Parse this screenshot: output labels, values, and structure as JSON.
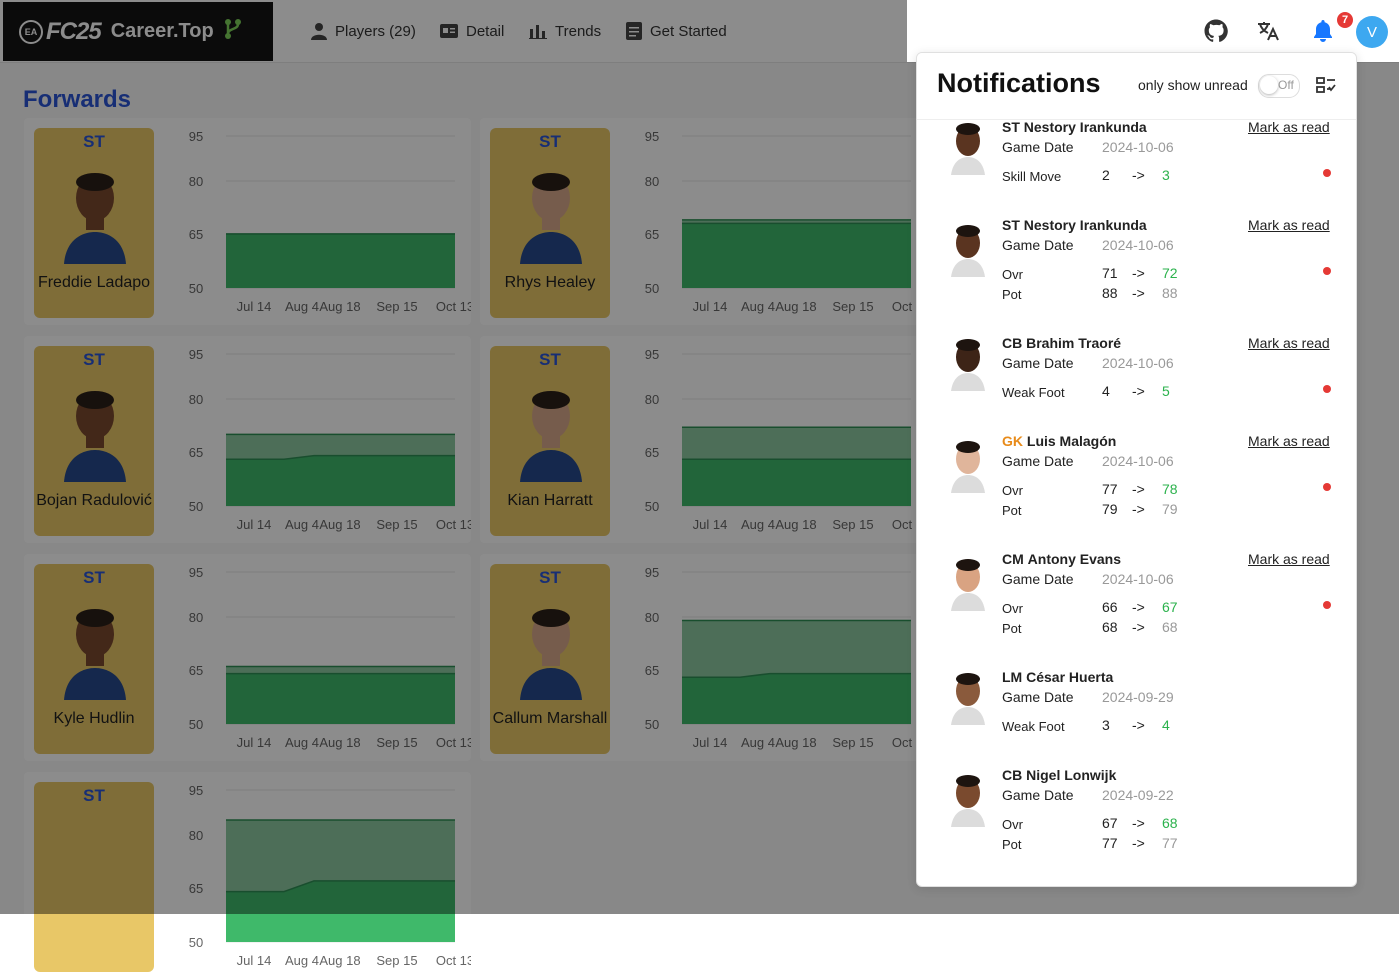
{
  "app": {
    "logo": {
      "ea": "EA",
      "fc": "FC25",
      "site": "Career.Top"
    },
    "nav": [
      {
        "label": "Players (29)",
        "icon": "person-icon"
      },
      {
        "label": "Detail",
        "icon": "id-card-icon"
      },
      {
        "label": "Trends",
        "icon": "bar-chart-icon"
      },
      {
        "label": "Get Started",
        "icon": "document-icon"
      }
    ],
    "section_title": "Forwards",
    "players": [
      {
        "pos": "ST",
        "name": "Freddie Ladapo"
      },
      {
        "pos": "ST",
        "name": "Rhys Healey"
      },
      {
        "pos": "ST",
        "name": "Bojan Radulović"
      },
      {
        "pos": "ST",
        "name": "Kian Harratt"
      },
      {
        "pos": "ST",
        "name": "Kyle Hudlin"
      },
      {
        "pos": "ST",
        "name": "Callum Marshall"
      },
      {
        "pos": "ST",
        "name": ""
      }
    ],
    "chart_y_ticks": [
      "95",
      "80",
      "65",
      "50"
    ],
    "chart_x_ticks": [
      "Jul 14",
      "Aug 4",
      "Aug 18",
      "Sep 15",
      "Oct 13"
    ]
  },
  "chart_data": [
    {
      "type": "area",
      "x": [
        "Jul 14",
        "Aug 4",
        "Aug 18",
        "Sep 15",
        "Oct 13"
      ],
      "ylim": [
        50,
        95
      ],
      "series": [
        {
          "values": [
            65,
            65,
            65,
            65,
            65
          ]
        },
        {
          "values": [
            65,
            65,
            65,
            65,
            65
          ]
        }
      ]
    },
    {
      "type": "area",
      "x": [
        "Jul 14",
        "Aug 4",
        "Aug 18",
        "Sep 15",
        "Oct 13"
      ],
      "ylim": [
        50,
        95
      ],
      "series": [
        {
          "values": [
            69,
            69,
            69,
            69,
            69
          ]
        },
        {
          "values": [
            68,
            68,
            68,
            68,
            68
          ]
        }
      ]
    },
    {
      "type": "area",
      "x": [
        "Jul 14",
        "Aug 4",
        "Aug 18",
        "Sep 15",
        "Oct 13"
      ],
      "ylim": [
        50,
        95
      ],
      "series": [
        {
          "values": [
            70,
            70,
            70,
            70,
            70
          ]
        },
        {
          "values": [
            63,
            63,
            64,
            64,
            64
          ]
        }
      ]
    },
    {
      "type": "area",
      "x": [
        "Jul 14",
        "Aug 4",
        "Aug 18",
        "Sep 15",
        "Oct 13"
      ],
      "ylim": [
        50,
        95
      ],
      "series": [
        {
          "values": [
            72,
            72,
            72,
            72,
            72
          ]
        },
        {
          "values": [
            63,
            63,
            63,
            63,
            63
          ]
        }
      ]
    },
    {
      "type": "area",
      "x": [
        "Jul 14",
        "Aug 4",
        "Aug 18",
        "Sep 15",
        "Oct 13"
      ],
      "ylim": [
        50,
        95
      ],
      "series": [
        {
          "values": [
            66,
            66,
            66,
            66,
            66
          ]
        },
        {
          "values": [
            64,
            64,
            64,
            64,
            64
          ]
        }
      ]
    },
    {
      "type": "area",
      "x": [
        "Jul 14",
        "Aug 4",
        "Aug 18",
        "Sep 15",
        "Oct 13"
      ],
      "ylim": [
        50,
        95
      ],
      "series": [
        {
          "values": [
            79,
            79,
            79,
            79,
            79
          ]
        },
        {
          "values": [
            63,
            63,
            64,
            64,
            64
          ]
        }
      ]
    },
    {
      "type": "area",
      "x": [
        "Jul 14",
        "Aug 4",
        "Aug 18",
        "Sep 15",
        "Oct 13"
      ],
      "ylim": [
        50,
        95
      ],
      "series": [
        {
          "values": [
            85,
            85,
            85,
            85,
            85
          ]
        },
        {
          "values": [
            64,
            64,
            67,
            67,
            67
          ]
        }
      ]
    }
  ],
  "header_icons": {
    "github": "github-icon",
    "translate": "translate-icon",
    "bell": "bell-icon",
    "badge": "7",
    "avatar": "V"
  },
  "colors": {
    "accent": "#2a55d6",
    "card_gold": "#e8c767",
    "green": "#2bb24c",
    "red": "#e53935",
    "chart_green": "#3fb96a"
  },
  "notifications": {
    "title": "Notifications",
    "unread_label": "only show unread",
    "toggle_text": "Off",
    "mark_label": "Mark as read",
    "items": [
      {
        "pos": "ST",
        "name": "Nestory Irankunda",
        "date_label": "Game Date",
        "date": "2024-10-06",
        "rows": [
          {
            "label": "Skill Move",
            "from": "2",
            "arrow": "->",
            "to": "3",
            "to_color": "green"
          }
        ],
        "unread": true
      },
      {
        "pos": "ST",
        "name": "Nestory Irankunda",
        "date_label": "Game Date",
        "date": "2024-10-06",
        "rows": [
          {
            "label": "Ovr",
            "from": "71",
            "arrow": "->",
            "to": "72",
            "to_color": "green"
          },
          {
            "label": "Pot",
            "from": "88",
            "arrow": "->",
            "to": "88",
            "to_color": "gray"
          }
        ],
        "unread": true
      },
      {
        "pos": "CB",
        "name": "Brahim Traoré",
        "date_label": "Game Date",
        "date": "2024-10-06",
        "rows": [
          {
            "label": "Weak Foot",
            "from": "4",
            "arrow": "->",
            "to": "5",
            "to_color": "green"
          }
        ],
        "unread": true
      },
      {
        "pos": "GK",
        "name": "Luis Malagón",
        "date_label": "Game Date",
        "date": "2024-10-06",
        "rows": [
          {
            "label": "Ovr",
            "from": "77",
            "arrow": "->",
            "to": "78",
            "to_color": "green"
          },
          {
            "label": "Pot",
            "from": "79",
            "arrow": "->",
            "to": "79",
            "to_color": "gray"
          }
        ],
        "unread": true
      },
      {
        "pos": "CM",
        "name": "Antony Evans",
        "date_label": "Game Date",
        "date": "2024-10-06",
        "rows": [
          {
            "label": "Ovr",
            "from": "66",
            "arrow": "->",
            "to": "67",
            "to_color": "green"
          },
          {
            "label": "Pot",
            "from": "68",
            "arrow": "->",
            "to": "68",
            "to_color": "gray"
          }
        ],
        "unread": true
      },
      {
        "pos": "LM",
        "name": "César Huerta",
        "date_label": "Game Date",
        "date": "2024-09-29",
        "rows": [
          {
            "label": "Weak Foot",
            "from": "3",
            "arrow": "->",
            "to": "4",
            "to_color": "green"
          }
        ],
        "unread": false
      },
      {
        "pos": "CB",
        "name": "Nigel Lonwijk",
        "date_label": "Game Date",
        "date": "2024-09-22",
        "rows": [
          {
            "label": "Ovr",
            "from": "67",
            "arrow": "->",
            "to": "68",
            "to_color": "green"
          },
          {
            "label": "Pot",
            "from": "77",
            "arrow": "->",
            "to": "77",
            "to_color": "gray"
          }
        ],
        "unread": false
      }
    ]
  }
}
